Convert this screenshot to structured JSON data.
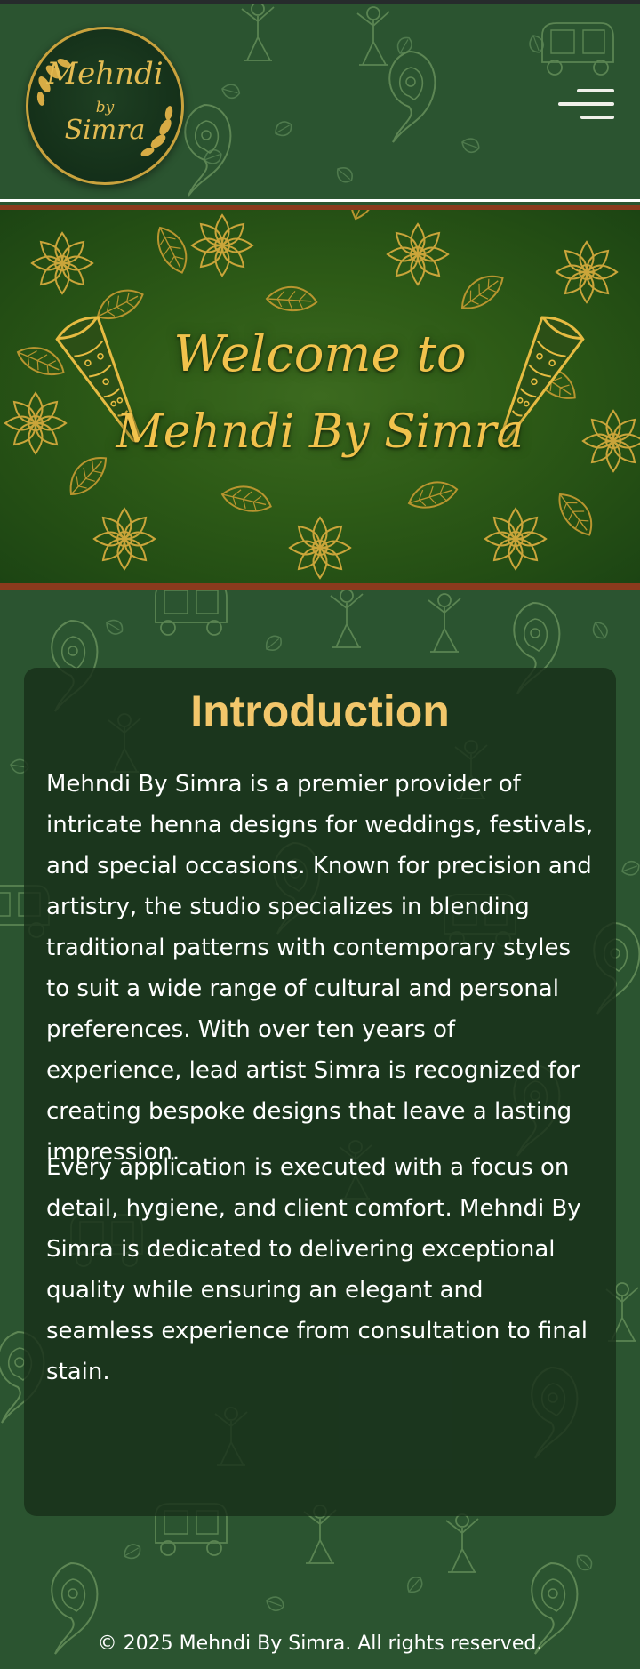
{
  "header": {
    "logo": {
      "line1": "Mehndi",
      "line2": "by",
      "line3": "Simra"
    },
    "menu_icon": "hamburger-menu-icon"
  },
  "hero": {
    "line1": "Welcome to",
    "line2": "Mehndi By Simra",
    "decor_icon": "henna-cone-icon"
  },
  "intro": {
    "title": "Introduction",
    "paragraph1": "Mehndi By Simra is a premier provider of intricate henna designs for weddings, festivals, and special occasions. Known for precision and artistry, the studio specializes in blending traditional patterns with contemporary styles to suit a wide range of cultural and personal preferences. With over ten years of experience, lead artist Simra is recognized for creating bespoke designs that leave a lasting impression.",
    "paragraph2": "Every application is executed with a focus on detail, hygiene, and client comfort. Mehndi By Simra is dedicated to delivering exceptional quality while ensuring an elegant and seamless experience from consultation to final stain."
  },
  "footer": {
    "copyright": "© 2025 Mehndi By Simra. All rights reserved."
  },
  "colors": {
    "page_background": "#2b5430",
    "gold_accent": "#f1c24c",
    "title_gold": "#f2c76b",
    "card_background": "#18301a",
    "divider_brown": "#8b3a1d"
  }
}
